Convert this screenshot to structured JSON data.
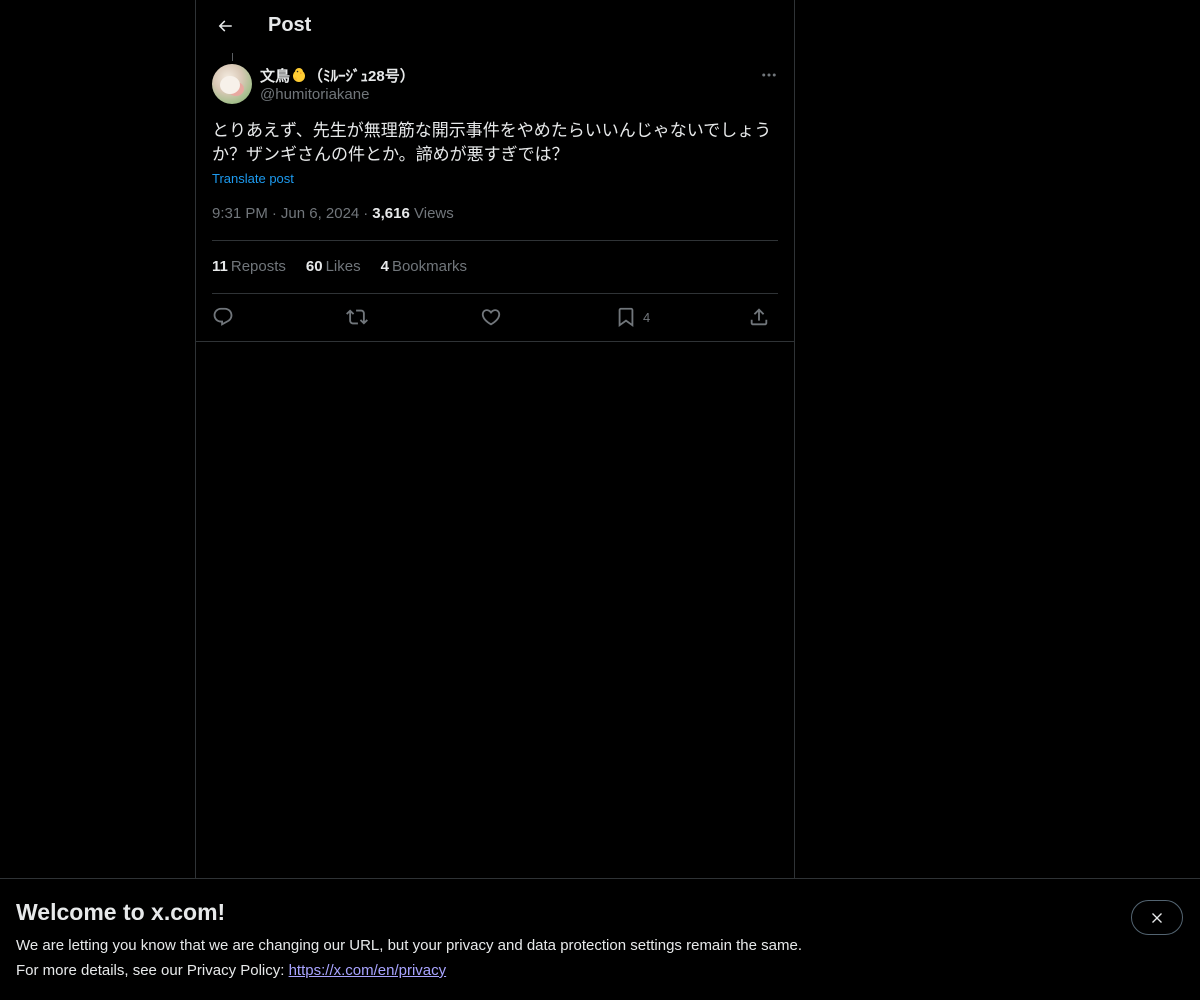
{
  "header": {
    "title": "Post"
  },
  "post": {
    "author": {
      "display_name": "文鳥",
      "display_name_suffix": "（ﾐﾙｰｼﾞｭ28号）",
      "handle": "@humitoriakane"
    },
    "text": "とりあえず、先生が無理筋な開示事件をやめたらいいんじゃないでしょうか？ザンギさんの件とか。諦めが悪すぎでは？",
    "translate_label": "Translate post",
    "time": "9:31 PM",
    "date": "Jun 6, 2024",
    "separator": "·",
    "views_count": "3,616",
    "views_label": "Views"
  },
  "stats": {
    "reposts_count": "11",
    "reposts_label": "Reposts",
    "likes_count": "60",
    "likes_label": "Likes",
    "bookmarks_count": "4",
    "bookmarks_label": "Bookmarks"
  },
  "actions": {
    "bookmark_count": "4"
  },
  "icons": {
    "back": "arrow-left-icon",
    "more": "more-horizontal-icon",
    "reply": "reply-icon",
    "repost": "repost-icon",
    "like": "heart-icon",
    "bookmark": "bookmark-icon",
    "share": "share-icon",
    "close": "close-icon",
    "emoji": "chick-emoji-icon"
  },
  "banner": {
    "title": "Welcome to x.com!",
    "line1": "We are letting you know that we are changing our URL, but your privacy and data protection settings remain the same.",
    "line2_prefix": "For more details, see our Privacy Policy: ",
    "link": "https://x.com/en/privacy"
  },
  "colors": {
    "background": "#000000",
    "text_primary": "#e7e9ea",
    "text_secondary": "#71767b",
    "accent": "#1d9bf0",
    "border": "#2f3336",
    "link_visited": "#a8a4ff"
  }
}
